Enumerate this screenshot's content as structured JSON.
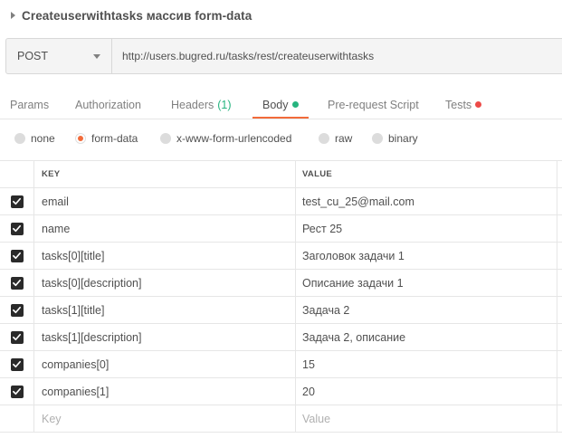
{
  "request": {
    "title": "Createuserwithtasks массив form-data",
    "method": "POST",
    "url": "http://users.bugred.ru/tasks/rest/createuserwithtasks"
  },
  "tabs": [
    {
      "label": "Params"
    },
    {
      "label": "Authorization"
    },
    {
      "label": "Headers",
      "count": "(1)"
    },
    {
      "label": "Body",
      "active": true,
      "dot_color": "#26b47f"
    },
    {
      "label": "Pre-request Script"
    },
    {
      "label": "Tests",
      "dot_color": "#ed4b48"
    }
  ],
  "body_types": [
    {
      "label": "none"
    },
    {
      "label": "form-data",
      "selected": true
    },
    {
      "label": "x-www-form-urlencoded"
    },
    {
      "label": "raw"
    },
    {
      "label": "binary"
    }
  ],
  "table": {
    "headers": {
      "key": "KEY",
      "value": "VALUE"
    },
    "rows": [
      {
        "key": "email",
        "value": "test_cu_25@mail.com",
        "checked": true
      },
      {
        "key": "name",
        "value": "Рест 25",
        "checked": true
      },
      {
        "key": "tasks[0][title]",
        "value": "Заголовок задачи 1",
        "checked": true
      },
      {
        "key": "tasks[0][description]",
        "value": "Описание задачи 1",
        "checked": true
      },
      {
        "key": "tasks[1][title]",
        "value": "Задача 2",
        "checked": true
      },
      {
        "key": "tasks[1][description]",
        "value": "Задача 2, описание",
        "checked": true
      },
      {
        "key": "companies[0]",
        "value": "15",
        "checked": true
      },
      {
        "key": "companies[1]",
        "value": "20",
        "checked": true
      }
    ],
    "placeholder": {
      "key": "Key",
      "value": "Value"
    }
  },
  "colors": {
    "accent": "#f26b3a",
    "success": "#26b47f",
    "danger": "#ed4b48"
  }
}
